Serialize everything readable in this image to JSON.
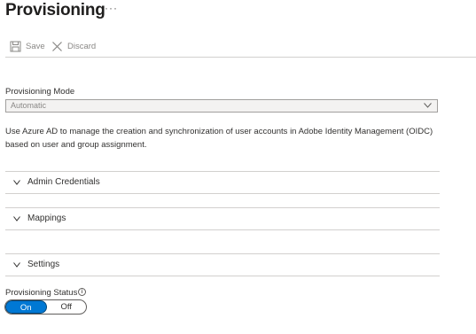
{
  "header": {
    "title": "Provisioning",
    "more_label": "···"
  },
  "toolbar": {
    "save_label": "Save",
    "discard_label": "Discard"
  },
  "provisioning_mode": {
    "label": "Provisioning Mode",
    "value": "Automatic"
  },
  "description": "Use Azure AD to manage the creation and synchronization of user accounts in Adobe Identity Management (OIDC) based on user and group assignment.",
  "sections": [
    {
      "label": "Admin Credentials"
    },
    {
      "label": "Mappings"
    },
    {
      "label": "Settings"
    }
  ],
  "provisioning_status": {
    "label": "Provisioning Status",
    "info_icon": "i",
    "on_label": "On",
    "off_label": "Off",
    "selected": "On"
  },
  "colors": {
    "accent": "#0078d4",
    "disabled_text": "#8a8886",
    "divider": "#d2d0ce"
  }
}
